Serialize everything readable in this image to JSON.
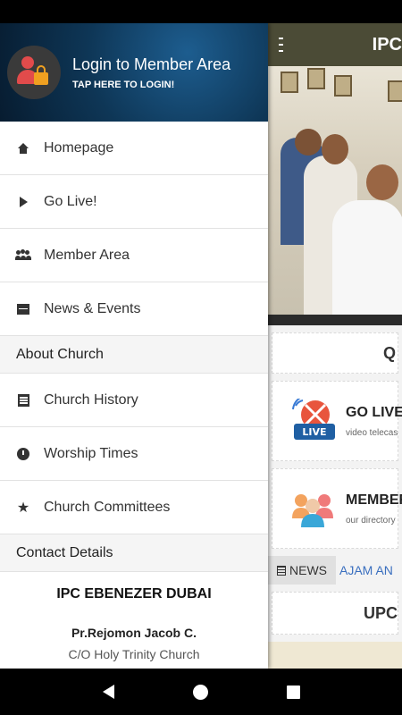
{
  "app": {
    "title": "IPC",
    "feature_cards": [
      {
        "title": "GO LIVE",
        "subtitle": "video telecas",
        "icon": "live-broadcast-icon"
      },
      {
        "title": "MEMBER",
        "subtitle": "our directory",
        "icon": "members-group-icon"
      }
    ],
    "quote_card_text": "Q",
    "tabs": {
      "news": "NEWS",
      "marquee": "AJAM AN"
    },
    "upcoming_card_text": "UPC"
  },
  "drawer": {
    "header": {
      "title": "Login to Member Area",
      "subtitle": "TAP HERE TO LOGIN!",
      "icon": "member-lock-icon"
    },
    "items": [
      {
        "label": "Homepage",
        "icon": "home-icon"
      },
      {
        "label": "Go Live!",
        "icon": "play-icon"
      },
      {
        "label": "Member Area",
        "icon": "users-icon"
      },
      {
        "label": "News & Events",
        "icon": "calendar-icon"
      }
    ],
    "sections": [
      {
        "title": "About Church",
        "items": [
          {
            "label": "Church History",
            "icon": "book-icon"
          },
          {
            "label": "Worship Times",
            "icon": "clock-icon"
          },
          {
            "label": "Church Committees",
            "icon": "star-icon"
          }
        ]
      },
      {
        "title": "Contact Details"
      }
    ],
    "contact": {
      "name": "IPC EBENEZER DUBAI",
      "pastor": "Pr.Rejomon Jacob C.",
      "address": "C/O Holy Trinity Church"
    }
  },
  "colors": {
    "toolbar": "#4b4b36",
    "drawer_header": "#0e3656",
    "link": "#3a6fbf"
  }
}
